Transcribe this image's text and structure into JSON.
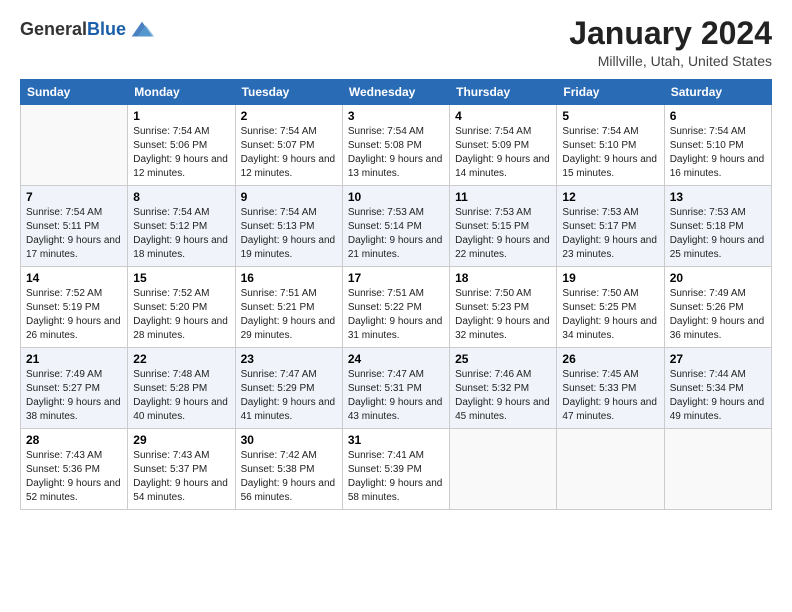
{
  "header": {
    "logo_general": "General",
    "logo_blue": "Blue",
    "month_title": "January 2024",
    "location": "Millville, Utah, United States"
  },
  "weekdays": [
    "Sunday",
    "Monday",
    "Tuesday",
    "Wednesday",
    "Thursday",
    "Friday",
    "Saturday"
  ],
  "weeks": [
    [
      {
        "day": "",
        "sunrise": "",
        "sunset": "",
        "daylight": ""
      },
      {
        "day": "1",
        "sunrise": "Sunrise: 7:54 AM",
        "sunset": "Sunset: 5:06 PM",
        "daylight": "Daylight: 9 hours and 12 minutes."
      },
      {
        "day": "2",
        "sunrise": "Sunrise: 7:54 AM",
        "sunset": "Sunset: 5:07 PM",
        "daylight": "Daylight: 9 hours and 12 minutes."
      },
      {
        "day": "3",
        "sunrise": "Sunrise: 7:54 AM",
        "sunset": "Sunset: 5:08 PM",
        "daylight": "Daylight: 9 hours and 13 minutes."
      },
      {
        "day": "4",
        "sunrise": "Sunrise: 7:54 AM",
        "sunset": "Sunset: 5:09 PM",
        "daylight": "Daylight: 9 hours and 14 minutes."
      },
      {
        "day": "5",
        "sunrise": "Sunrise: 7:54 AM",
        "sunset": "Sunset: 5:10 PM",
        "daylight": "Daylight: 9 hours and 15 minutes."
      },
      {
        "day": "6",
        "sunrise": "Sunrise: 7:54 AM",
        "sunset": "Sunset: 5:10 PM",
        "daylight": "Daylight: 9 hours and 16 minutes."
      }
    ],
    [
      {
        "day": "7",
        "sunrise": "Sunrise: 7:54 AM",
        "sunset": "Sunset: 5:11 PM",
        "daylight": "Daylight: 9 hours and 17 minutes."
      },
      {
        "day": "8",
        "sunrise": "Sunrise: 7:54 AM",
        "sunset": "Sunset: 5:12 PM",
        "daylight": "Daylight: 9 hours and 18 minutes."
      },
      {
        "day": "9",
        "sunrise": "Sunrise: 7:54 AM",
        "sunset": "Sunset: 5:13 PM",
        "daylight": "Daylight: 9 hours and 19 minutes."
      },
      {
        "day": "10",
        "sunrise": "Sunrise: 7:53 AM",
        "sunset": "Sunset: 5:14 PM",
        "daylight": "Daylight: 9 hours and 21 minutes."
      },
      {
        "day": "11",
        "sunrise": "Sunrise: 7:53 AM",
        "sunset": "Sunset: 5:15 PM",
        "daylight": "Daylight: 9 hours and 22 minutes."
      },
      {
        "day": "12",
        "sunrise": "Sunrise: 7:53 AM",
        "sunset": "Sunset: 5:17 PM",
        "daylight": "Daylight: 9 hours and 23 minutes."
      },
      {
        "day": "13",
        "sunrise": "Sunrise: 7:53 AM",
        "sunset": "Sunset: 5:18 PM",
        "daylight": "Daylight: 9 hours and 25 minutes."
      }
    ],
    [
      {
        "day": "14",
        "sunrise": "Sunrise: 7:52 AM",
        "sunset": "Sunset: 5:19 PM",
        "daylight": "Daylight: 9 hours and 26 minutes."
      },
      {
        "day": "15",
        "sunrise": "Sunrise: 7:52 AM",
        "sunset": "Sunset: 5:20 PM",
        "daylight": "Daylight: 9 hours and 28 minutes."
      },
      {
        "day": "16",
        "sunrise": "Sunrise: 7:51 AM",
        "sunset": "Sunset: 5:21 PM",
        "daylight": "Daylight: 9 hours and 29 minutes."
      },
      {
        "day": "17",
        "sunrise": "Sunrise: 7:51 AM",
        "sunset": "Sunset: 5:22 PM",
        "daylight": "Daylight: 9 hours and 31 minutes."
      },
      {
        "day": "18",
        "sunrise": "Sunrise: 7:50 AM",
        "sunset": "Sunset: 5:23 PM",
        "daylight": "Daylight: 9 hours and 32 minutes."
      },
      {
        "day": "19",
        "sunrise": "Sunrise: 7:50 AM",
        "sunset": "Sunset: 5:25 PM",
        "daylight": "Daylight: 9 hours and 34 minutes."
      },
      {
        "day": "20",
        "sunrise": "Sunrise: 7:49 AM",
        "sunset": "Sunset: 5:26 PM",
        "daylight": "Daylight: 9 hours and 36 minutes."
      }
    ],
    [
      {
        "day": "21",
        "sunrise": "Sunrise: 7:49 AM",
        "sunset": "Sunset: 5:27 PM",
        "daylight": "Daylight: 9 hours and 38 minutes."
      },
      {
        "day": "22",
        "sunrise": "Sunrise: 7:48 AM",
        "sunset": "Sunset: 5:28 PM",
        "daylight": "Daylight: 9 hours and 40 minutes."
      },
      {
        "day": "23",
        "sunrise": "Sunrise: 7:47 AM",
        "sunset": "Sunset: 5:29 PM",
        "daylight": "Daylight: 9 hours and 41 minutes."
      },
      {
        "day": "24",
        "sunrise": "Sunrise: 7:47 AM",
        "sunset": "Sunset: 5:31 PM",
        "daylight": "Daylight: 9 hours and 43 minutes."
      },
      {
        "day": "25",
        "sunrise": "Sunrise: 7:46 AM",
        "sunset": "Sunset: 5:32 PM",
        "daylight": "Daylight: 9 hours and 45 minutes."
      },
      {
        "day": "26",
        "sunrise": "Sunrise: 7:45 AM",
        "sunset": "Sunset: 5:33 PM",
        "daylight": "Daylight: 9 hours and 47 minutes."
      },
      {
        "day": "27",
        "sunrise": "Sunrise: 7:44 AM",
        "sunset": "Sunset: 5:34 PM",
        "daylight": "Daylight: 9 hours and 49 minutes."
      }
    ],
    [
      {
        "day": "28",
        "sunrise": "Sunrise: 7:43 AM",
        "sunset": "Sunset: 5:36 PM",
        "daylight": "Daylight: 9 hours and 52 minutes."
      },
      {
        "day": "29",
        "sunrise": "Sunrise: 7:43 AM",
        "sunset": "Sunset: 5:37 PM",
        "daylight": "Daylight: 9 hours and 54 minutes."
      },
      {
        "day": "30",
        "sunrise": "Sunrise: 7:42 AM",
        "sunset": "Sunset: 5:38 PM",
        "daylight": "Daylight: 9 hours and 56 minutes."
      },
      {
        "day": "31",
        "sunrise": "Sunrise: 7:41 AM",
        "sunset": "Sunset: 5:39 PM",
        "daylight": "Daylight: 9 hours and 58 minutes."
      },
      {
        "day": "",
        "sunrise": "",
        "sunset": "",
        "daylight": ""
      },
      {
        "day": "",
        "sunrise": "",
        "sunset": "",
        "daylight": ""
      },
      {
        "day": "",
        "sunrise": "",
        "sunset": "",
        "daylight": ""
      }
    ]
  ]
}
